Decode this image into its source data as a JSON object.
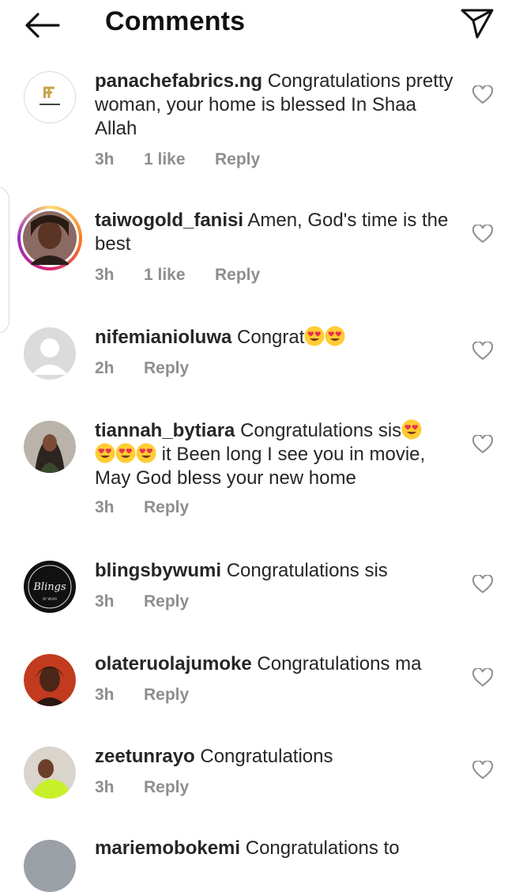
{
  "header": {
    "title": "Comments"
  },
  "comments": [
    {
      "username": "panachefabrics.ng",
      "text": "Congratulations pretty woman, your home is blessed In Shaa Allah",
      "time": "3h",
      "likes": "1 like",
      "reply": "Reply",
      "avatar_text": "Panache fabrics"
    },
    {
      "username": "taiwogold_fanisi",
      "text": "Amen, God's time is the best",
      "time": "3h",
      "likes": "1 like",
      "reply": "Reply"
    },
    {
      "username": "nifemianioluwa",
      "text": "Congrat",
      "time": "2h",
      "reply": "Reply"
    },
    {
      "username": "tiannah_bytiara",
      "text_a": "Congratulations sis",
      "text_b": "it Been long I see you in movie, May God bless your new home",
      "time": "3h",
      "reply": "Reply"
    },
    {
      "username": "blingsbywumi",
      "text": "Congratulations sis",
      "time": "3h",
      "reply": "Reply",
      "avatar_text": "Blings",
      "avatar_sub": "BY WUMI"
    },
    {
      "username": "olateruolajumoke",
      "text": "Congratulations ma",
      "time": "3h",
      "reply": "Reply"
    },
    {
      "username": "zeetunrayo",
      "text": "Congratulations",
      "time": "3h",
      "reply": "Reply"
    },
    {
      "username": "mariemobokemi",
      "text": "Congratulations to"
    }
  ],
  "colors": {
    "muted": "#8e8e8e",
    "text": "#262626",
    "story_ring": [
      "#feda75",
      "#fa7e1e",
      "#d62976",
      "#962fbf"
    ]
  }
}
